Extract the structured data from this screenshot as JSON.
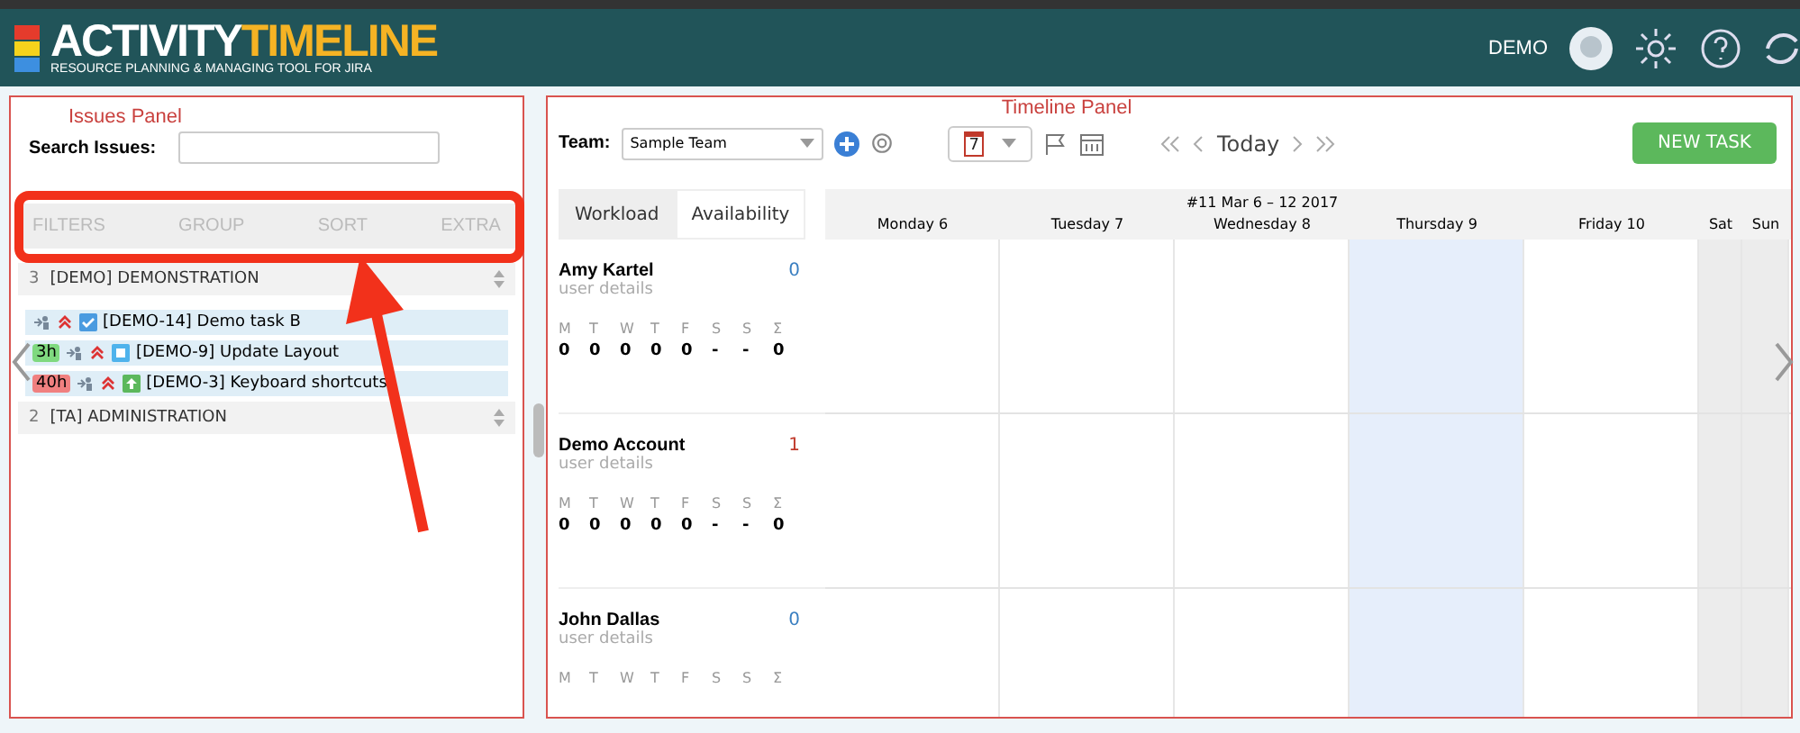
{
  "header": {
    "logo_first": "ACTIVITY",
    "logo_second": "TIMELINE",
    "tagline": "RESOURCE PLANNING & MANAGING TOOL FOR JIRA",
    "user": "DEMO"
  },
  "issues_panel": {
    "annotation": "Issues Panel",
    "search_label": "Search Issues:",
    "tabs": [
      {
        "label": "FILTERS",
        "disabled": true
      },
      {
        "label": "GROUP",
        "disabled": true
      },
      {
        "label": "SORT",
        "disabled": true
      },
      {
        "label": "EXTRA",
        "disabled": true
      }
    ],
    "groups": [
      {
        "count": "3",
        "label": "[DEMO] DEMONSTRATION",
        "children": [
          {
            "kind": "task",
            "label": "[DEMO-14] Demo task B"
          },
          {
            "hours": "3h",
            "color": "#7fd97f",
            "kind": "story",
            "label": "[DEMO-9] Update Layout"
          },
          {
            "hours": "40h",
            "color": "#f08080",
            "kind": "improvement",
            "label": "[DEMO-3] Keyboard shortcuts"
          }
        ]
      },
      {
        "count": "2",
        "label": "[TA] ADMINISTRATION"
      }
    ]
  },
  "timeline_panel": {
    "annotation": "Timeline Panel",
    "team_label": "Team:",
    "team_value": "Sample Team",
    "calendar_day": "7",
    "today": "Today",
    "new_task": "NEW TASK",
    "view_tabs": [
      {
        "label": "Workload",
        "selected": false
      },
      {
        "label": "Availability",
        "selected": true
      }
    ],
    "week": "#11 Mar 6 – 12 2017",
    "days": [
      {
        "label": "Monday 6",
        "today": false,
        "weekend": false
      },
      {
        "label": "Tuesday 7",
        "today": false,
        "weekend": false
      },
      {
        "label": "Wednesday 8",
        "today": false,
        "weekend": false
      },
      {
        "label": "Thursday 9",
        "today": true,
        "weekend": false
      },
      {
        "label": "Friday 10",
        "today": false,
        "weekend": false
      },
      {
        "label": "Sat",
        "today": false,
        "weekend": true
      },
      {
        "label": "Sun",
        "today": false,
        "weekend": true
      }
    ],
    "users": [
      {
        "name": "Amy Kartel",
        "details": "user details",
        "count": "0",
        "color": "#3a7fc1",
        "letters": [
          "M",
          "T",
          "W",
          "T",
          "F",
          "S",
          "S",
          "Σ"
        ],
        "values": [
          "0",
          "0",
          "0",
          "0",
          "0",
          "-",
          "-",
          "0"
        ]
      },
      {
        "name": "Demo Account",
        "details": "user details",
        "count": "1",
        "color": "#c0392b",
        "letters": [
          "M",
          "T",
          "W",
          "T",
          "F",
          "S",
          "S",
          "Σ"
        ],
        "values": [
          "0",
          "0",
          "0",
          "0",
          "0",
          "-",
          "-",
          "0"
        ]
      },
      {
        "name": "John Dallas",
        "details": "user details",
        "count": "0",
        "color": "#3a7fc1",
        "letters": [
          "M",
          "T",
          "W",
          "T",
          "F",
          "S",
          "S",
          "Σ"
        ]
      }
    ]
  }
}
